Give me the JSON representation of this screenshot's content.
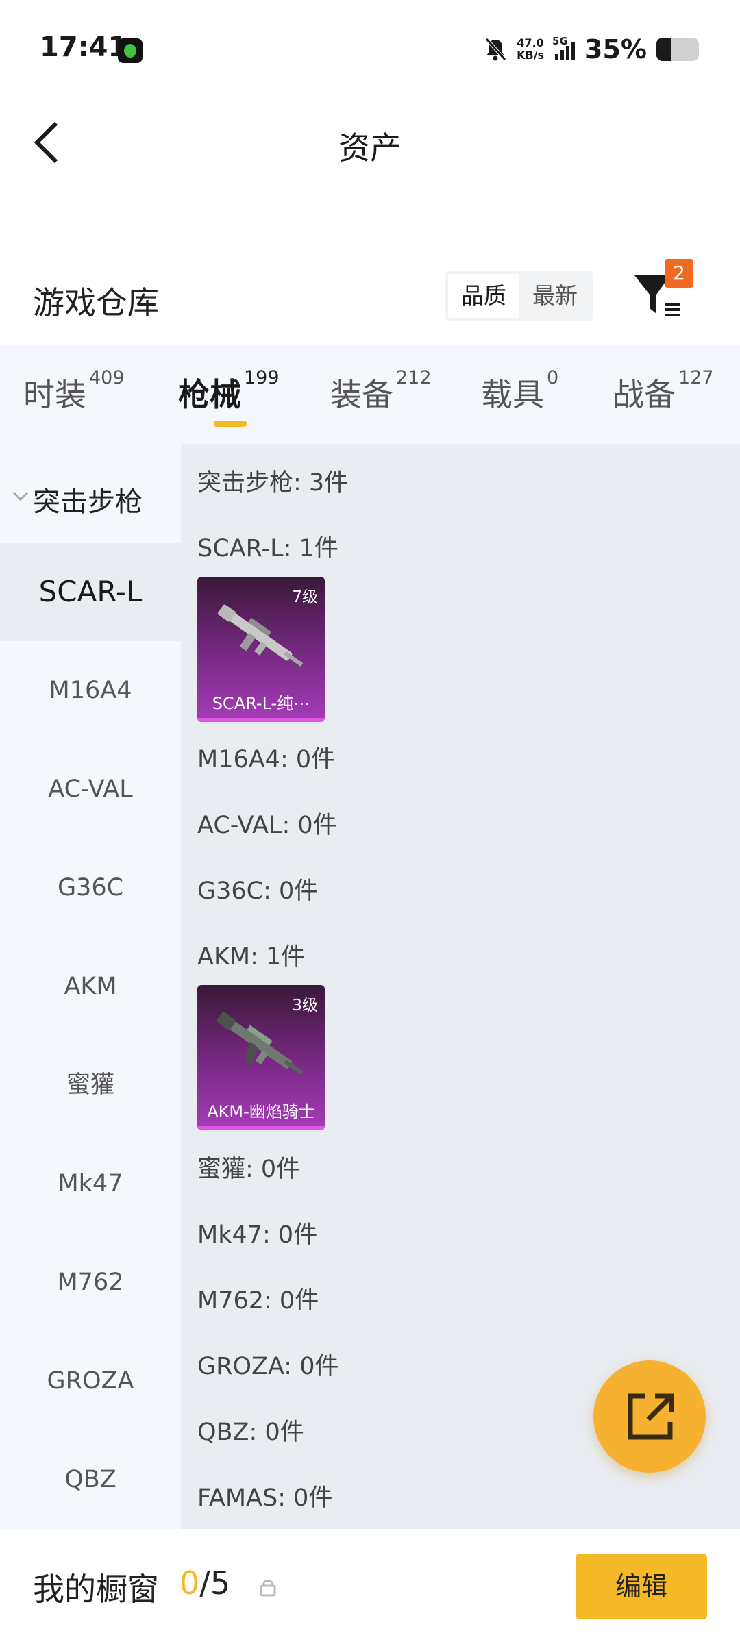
{
  "status_bar": {
    "time": "17:41",
    "net_speed_value": "47.0",
    "net_speed_unit": "KB/s",
    "network": "5G",
    "battery_text": "35%",
    "battery_level": 0.35
  },
  "header": {
    "title": "资产"
  },
  "warehouse": {
    "title": "游戏仓库",
    "sort_options": [
      "品质",
      "最新"
    ],
    "sort_selected": "品质",
    "filter_badge": "2"
  },
  "tabs": [
    {
      "label": "时装",
      "count": "409"
    },
    {
      "label": "枪械",
      "count": "199",
      "active": true
    },
    {
      "label": "装备",
      "count": "212"
    },
    {
      "label": "载具",
      "count": "0"
    },
    {
      "label": "战备",
      "count": "127"
    }
  ],
  "sidebar": {
    "group": "突击步枪",
    "items": [
      "SCAR-L",
      "M16A4",
      "AC-VAL",
      "G36C",
      "AKM",
      "蜜獾",
      "Mk47",
      "M762",
      "GROZA",
      "QBZ"
    ],
    "selected": "SCAR-L"
  },
  "content": {
    "group_summary": "突击步枪: 3件",
    "rows": [
      {
        "label": "SCAR-L: 1件",
        "card": {
          "level": "7级",
          "name": "SCAR-L-纯⋯"
        }
      },
      {
        "label": "M16A4: 0件"
      },
      {
        "label": "AC-VAL: 0件"
      },
      {
        "label": "G36C: 0件"
      },
      {
        "label": "AKM: 1件",
        "card": {
          "level": "3级",
          "name": "AKM-幽焰骑士"
        }
      },
      {
        "label": "蜜獾: 0件"
      },
      {
        "label": "Mk47: 0件"
      },
      {
        "label": "M762: 0件"
      },
      {
        "label": "GROZA: 0件"
      },
      {
        "label": "QBZ: 0件"
      },
      {
        "label": "FAMAS: 0件"
      }
    ]
  },
  "bottom_bar": {
    "label": "我的橱窗",
    "current": "0",
    "total": "/5",
    "edit_label": "编辑"
  },
  "colors": {
    "accent": "#f5b927",
    "badge": "#f26a21",
    "card_purple": "#7a2a86"
  },
  "icons": [
    "back-arrow-icon",
    "bell-off-icon",
    "signal-icon",
    "battery-icon",
    "filter-icon",
    "share-icon",
    "lock-icon",
    "chevron-down-icon"
  ]
}
